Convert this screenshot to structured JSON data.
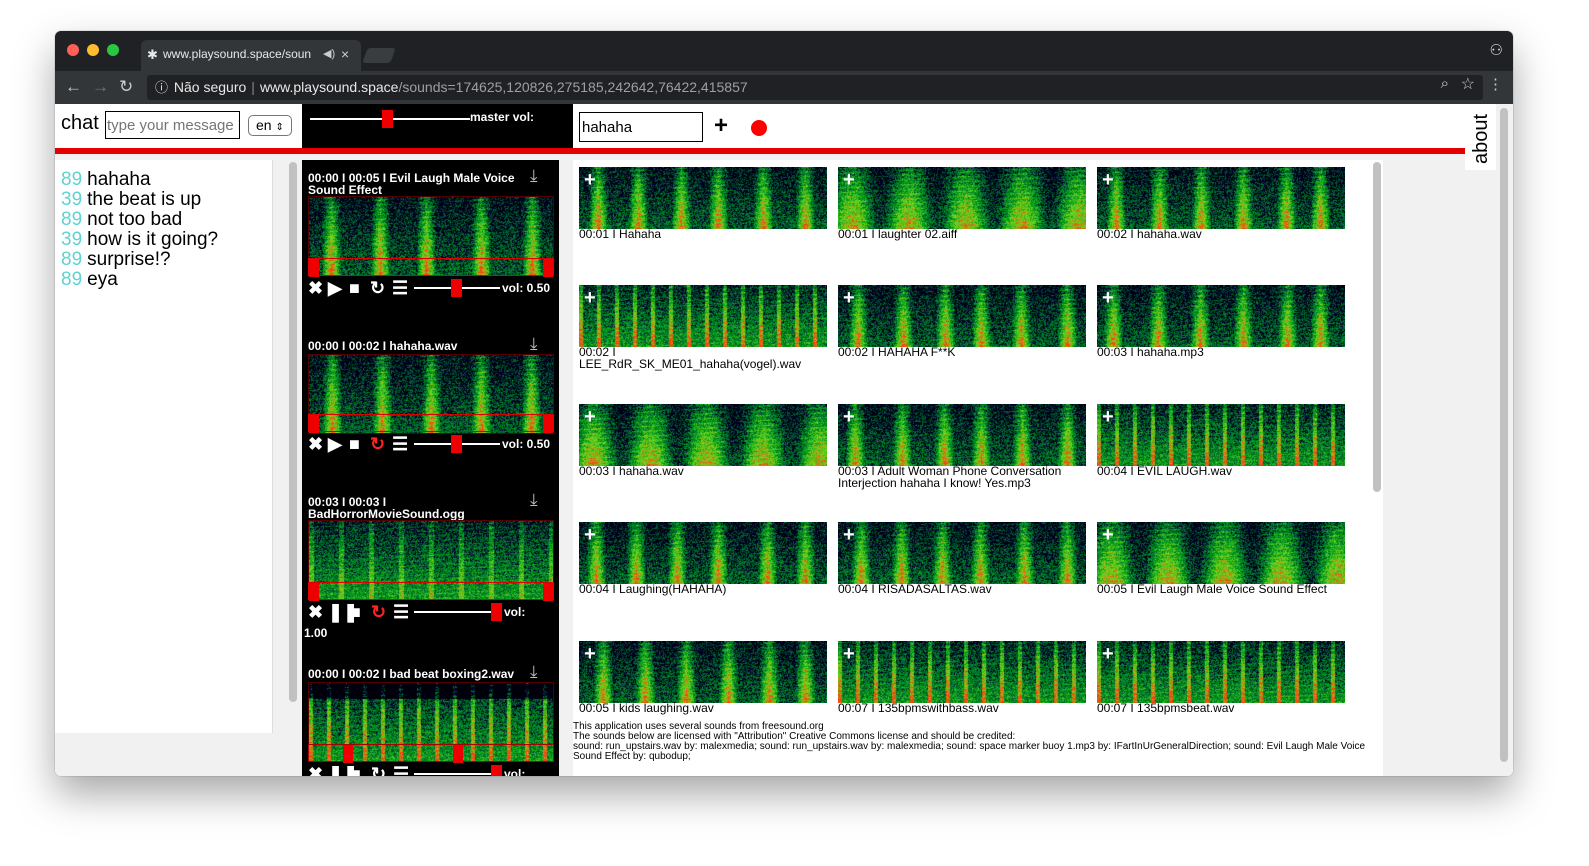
{
  "browser": {
    "tab_title": "www.playsound.space/soun",
    "url_secure_label": "Não seguro",
    "url_host": "www.playsound.space",
    "url_path": "/sounds=174625,120826,275185,242642,76422,415857"
  },
  "chat": {
    "label": "chat",
    "input_placeholder": "type your message h",
    "language": "en",
    "messages": [
      {
        "user": "89",
        "text": "hahaha"
      },
      {
        "user": "39",
        "text": "the beat is up"
      },
      {
        "user": "89",
        "text": "not too bad"
      },
      {
        "user": "39",
        "text": "how is it going?"
      },
      {
        "user": "89",
        "text": "surprise!?"
      },
      {
        "user": "89",
        "text": "eya"
      }
    ]
  },
  "mixer": {
    "master_label": "master vol:",
    "master_volume": 0.5,
    "tracks": [
      {
        "title": "00:00 I 00:05 I Evil Laugh Male Voice Sound Effect",
        "volume_label": "vol: 0.50",
        "volume": 0.5,
        "state": "stopped",
        "loop": false
      },
      {
        "title": "00:00 I 00:02 I hahaha.wav",
        "volume_label": "vol: 0.50",
        "volume": 0.5,
        "state": "stopped",
        "loop": true
      },
      {
        "title": "00:03 I 00:03 I BadHorrorMovieSound.ogg",
        "volume_label": "vol:",
        "volume_value": "1.00",
        "volume": 1.0,
        "state": "playing",
        "loop": true
      },
      {
        "title": "00:00 I 00:02 I bad beat boxing2.wav",
        "volume_label": "vol:",
        "volume": 1.0,
        "state": "playing",
        "loop": false
      }
    ]
  },
  "search": {
    "query": "hahaha"
  },
  "about": {
    "label": "about"
  },
  "results": [
    {
      "label": "00:01 I Hahaha"
    },
    {
      "label": "00:01 I laughter 02.aiff"
    },
    {
      "label": "00:02 I hahaha.wav"
    },
    {
      "label": "00:02 I LEE_RdR_SK_ME01_hahaha(vogel).wav"
    },
    {
      "label": "00:02 I HAHAHA F**K"
    },
    {
      "label": "00:03 I hahaha.mp3"
    },
    {
      "label": "00:03 I hahaha.wav"
    },
    {
      "label": "00:03 I Adult Woman Phone Conversation Interjection hahaha I know! Yes.mp3"
    },
    {
      "label": "00:04 I EVIL LAUGH.wav"
    },
    {
      "label": "00:04 I Laughing(HAHAHA)"
    },
    {
      "label": "00:04 I RISADASALTAS.wav"
    },
    {
      "label": "00:05 I Evil Laugh Male Voice Sound Effect"
    },
    {
      "label": "00:05 I kids laughing.wav"
    },
    {
      "label": "00:07 I 135bpmswithbass.wav"
    },
    {
      "label": "00:07 I 135bpmsbeat.wav"
    }
  ],
  "attribution": {
    "line1": "This application uses several sounds from freesound.org",
    "line2": "The sounds below are licensed with \"Attribution\" Creative Commons license and should be credited:",
    "line3": "sound: run_upstairs.wav by: malexmedia; sound: run_upstairs.wav by: malexmedia; sound: space marker buoy 1.mp3 by: IFartInUrGeneralDirection; sound: Evil Laugh Male Voice Sound Effect by: qubodup;"
  },
  "colors": {
    "accent_red": "#e40000",
    "chat_user_id": "#5fd3d0"
  }
}
